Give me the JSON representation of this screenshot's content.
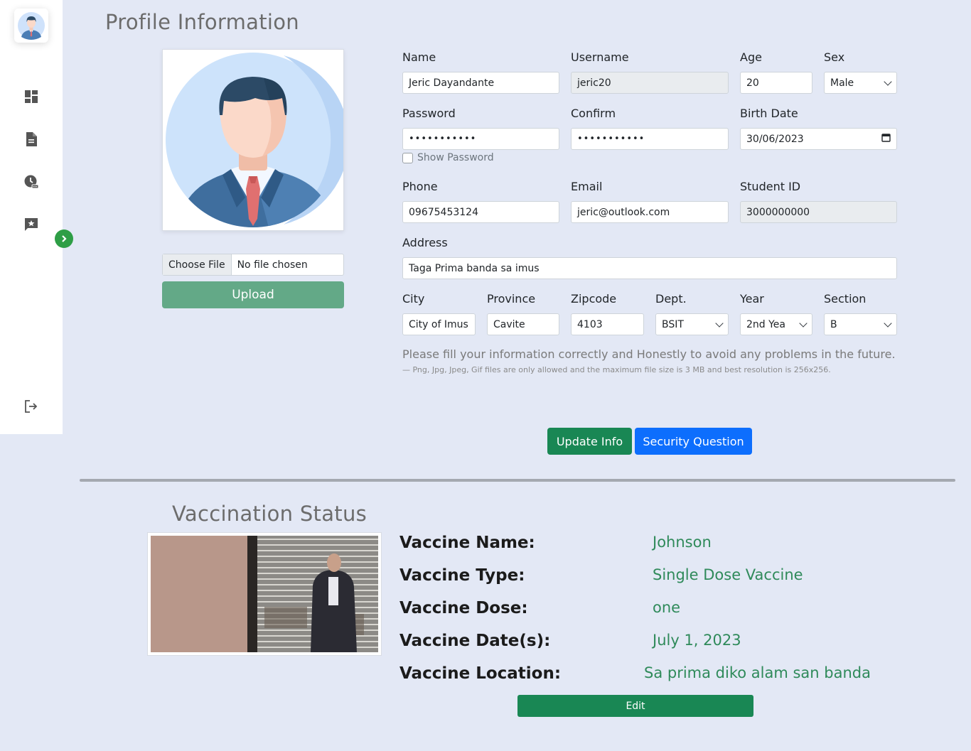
{
  "sidebar": {
    "avatar_icon": "user-avatar-icon",
    "items": [
      {
        "icon": "dashboard-icon"
      },
      {
        "icon": "document-icon"
      },
      {
        "icon": "vaccine-history-icon"
      },
      {
        "icon": "feedback-icon"
      }
    ],
    "logout_icon": "logout-icon",
    "toggle_icon": "chevron-right-icon"
  },
  "profile": {
    "title": "Profile Information",
    "file_button": "Choose File",
    "file_status": "No file chosen",
    "upload_label": "Upload",
    "fields": {
      "name": {
        "label": "Name",
        "value": "Jeric Dayandante"
      },
      "username": {
        "label": "Username",
        "value": "jeric20"
      },
      "age": {
        "label": "Age",
        "value": "20"
      },
      "sex": {
        "label": "Sex",
        "value": "Male"
      },
      "password": {
        "label": "Password",
        "value": "•••••••••••"
      },
      "confirm": {
        "label": "Confirm",
        "value": "•••••••••••"
      },
      "birth_date": {
        "label": "Birth Date",
        "value": "30/06/2023"
      },
      "show_password": "Show Password",
      "phone": {
        "label": "Phone",
        "value": "09675453124"
      },
      "email": {
        "label": "Email",
        "value": "jeric@outlook.com"
      },
      "student_id": {
        "label": "Student ID",
        "value": "3000000000"
      },
      "address": {
        "label": "Address",
        "value": "Taga Prima banda sa imus"
      },
      "city": {
        "label": "City",
        "value": "City of Imus"
      },
      "province": {
        "label": "Province",
        "value": "Cavite"
      },
      "zipcode": {
        "label": "Zipcode",
        "value": "4103"
      },
      "dept": {
        "label": "Dept.",
        "value": "BSIT"
      },
      "year": {
        "label": "Year",
        "value": "2nd Yea"
      },
      "section": {
        "label": "Section",
        "value": "B"
      }
    },
    "note": "Please fill your information correctly and Honestly to avoid any problems in the future.",
    "note_small": "— Png, Jpg, Jpeg, Gif files are only allowed and the maximum file size is 3 MB and best resolution is 256x256.",
    "update_label": "Update Info",
    "security_label": "Security Question"
  },
  "vaccination": {
    "title": "Vaccination Status",
    "rows": [
      {
        "key": "Vaccine Name:",
        "value": "Johnson"
      },
      {
        "key": "Vaccine Type:",
        "value": "Single Dose Vaccine"
      },
      {
        "key": "Vaccine Dose:",
        "value": "one"
      },
      {
        "key": "Vaccine Date(s):",
        "value": "July 1, 2023"
      },
      {
        "key": "Vaccine Location:",
        "value": "Sa prima diko alam san banda"
      }
    ],
    "edit_label": "Edit"
  },
  "colors": {
    "background": "#e3e8f5",
    "primary_green": "#198754",
    "upload_green": "#63a987",
    "primary_blue": "#0d6efd",
    "value_green": "#2f8a5a"
  }
}
